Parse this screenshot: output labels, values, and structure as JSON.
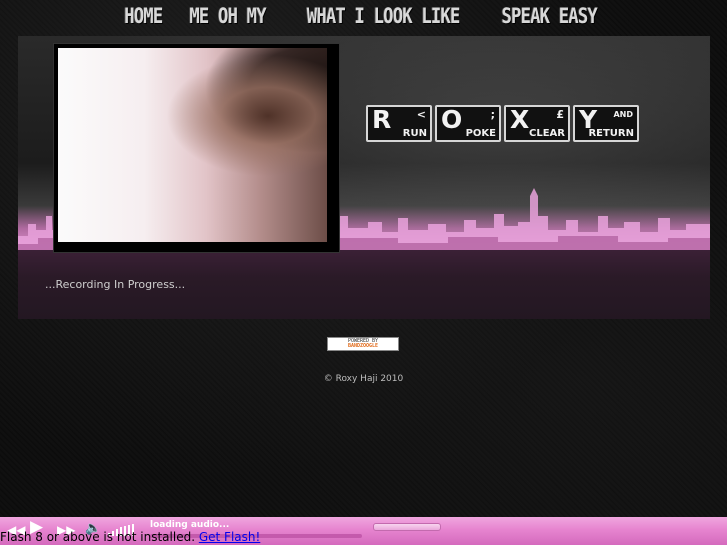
{
  "nav": {
    "items": [
      "HOME",
      "ME OH MY",
      "WHAT I LOOK LIKE",
      "SPEAK EASY"
    ]
  },
  "banner": {
    "status_text": "...Recording In Progress..."
  },
  "keys": [
    {
      "letter": "R",
      "symbol": "<",
      "sub": "RUN"
    },
    {
      "letter": "O",
      "symbol": ";",
      "sub": "POKE"
    },
    {
      "letter": "X",
      "symbol": "£",
      "sub": "CLEAR"
    },
    {
      "letter": "Y",
      "symbol": "AND",
      "sub": "RETURN"
    }
  ],
  "badge": {
    "line1": "POWERED BY",
    "line2": "BANDZOOGLE"
  },
  "footer": {
    "copyright": "© Roxy Haji 2010"
  },
  "player": {
    "loading_text": "loading audio...",
    "seek_progress_percent": 0,
    "flash_message": "Flash 8 or above is not installed.",
    "flash_link": "Get Flash!"
  },
  "colors": {
    "player_pink": "#e684cf",
    "banner_pink": "#d98ac8",
    "background": "#0b0b0b"
  }
}
